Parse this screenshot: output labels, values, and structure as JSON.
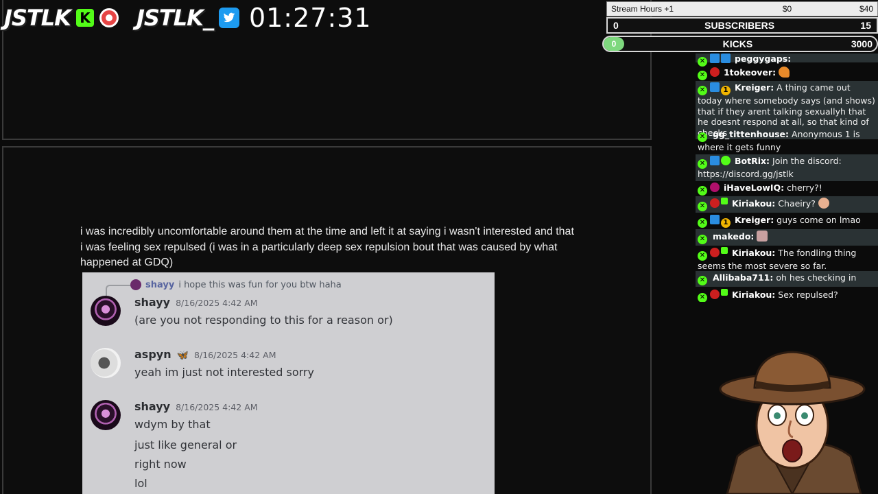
{
  "overlay": {
    "brand_name": "JSTLK",
    "kick_badge": "K",
    "brand_name_2": "JSTLK_",
    "clock": "01:27:31"
  },
  "stats": {
    "hours_label": "Stream Hours +1",
    "hours_min": "$0",
    "hours_max": "$40",
    "subs_current": "0",
    "subs_label": "SUBSCRIBERS",
    "subs_goal": "15",
    "kicks_current": "0",
    "kicks_label": "KICKS",
    "kicks_goal": "3000"
  },
  "document": {
    "text": "i was incredibly uncomfortable around them at the time and left it at saying i wasn't interested and that i was feeling sex repulsed (i was in a particularly deep sex repulsion bout that was caused by what happened at GDQ)"
  },
  "discord": {
    "reply": {
      "name": "shayy",
      "text": "i hope this was fun for you btw haha"
    },
    "messages": [
      {
        "name": "shayy",
        "time": "8/16/2025 4:42 AM",
        "lines": [
          "(are you not responding to this for a reason or)"
        ]
      },
      {
        "name": "aspyn",
        "time": "8/16/2025 4:42 AM",
        "lines": [
          "yeah im just not interested sorry"
        ]
      },
      {
        "name": "shayy",
        "time": "8/16/2025 4:42 AM",
        "lines": [
          "wdym by that",
          "just like general or",
          "right now",
          "lol"
        ]
      }
    ]
  },
  "chat": {
    "messages": [
      {
        "user": "peggygaps:",
        "text": ""
      },
      {
        "user": "1tokeover:",
        "text": ""
      },
      {
        "user": "Kreiger:",
        "text": "A thing came out today where somebody says (and shows) that if they arent talking sexuallyh that he doesnt respond at all, so that kind of checks"
      },
      {
        "user": "gg_tittenhouse:",
        "text": "Anonymous 1 is where it gets funny"
      },
      {
        "user": "BotRix:",
        "text": "Join the discord: https://discord.gg/jstlk"
      },
      {
        "user": "iHaveLowIQ:",
        "text": "cherry?!"
      },
      {
        "user": "Kiriakou:",
        "text": "Chaeiry?"
      },
      {
        "user": "Kreiger:",
        "text": "guys come on lmao"
      },
      {
        "user": "makedo:",
        "text": ""
      },
      {
        "user": "Kiriakou:",
        "text": "The fondling thing seems the most severe so far."
      },
      {
        "user": "Allibaba711:",
        "text": "oh hes checking in"
      },
      {
        "user": "Kiriakou:",
        "text": "Sex repulsed?"
      }
    ]
  },
  "colors": {
    "kick_green": "#53fc18",
    "discord_bg": "#cfcfd2",
    "twitter_blue": "#1d9bf0"
  },
  "icons": [
    "kick-logo-icon",
    "record-icon",
    "twitter-icon",
    "kick-chat-badge-icon",
    "butterfly-icon"
  ]
}
